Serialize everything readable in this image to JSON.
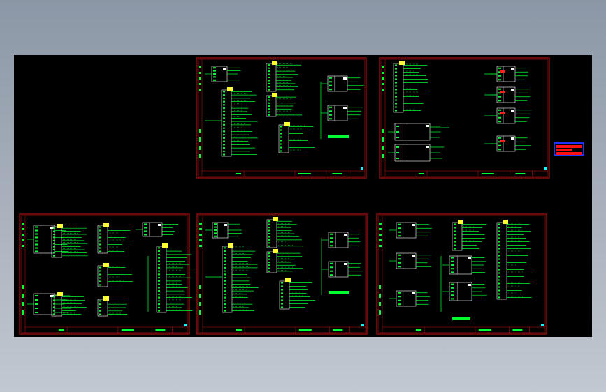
{
  "colors": {
    "background_gradient_top": "#8b97a6",
    "background_gradient_bottom": "#c2c8d0",
    "model_space": "#000000",
    "frame": "#c81414",
    "wire": "#00ff33",
    "terminal_strip": "#ffff33",
    "symbol": "#ffffff",
    "legend_border": "#2233ff",
    "legend_fill": "#ff1010"
  },
  "sheets": [
    {
      "id": "sheet-1",
      "layout": "plc-center"
    },
    {
      "id": "sheet-2",
      "layout": "modules-right"
    },
    {
      "id": "sheet-3",
      "layout": "mixed-left"
    },
    {
      "id": "sheet-4",
      "layout": "plc-center"
    },
    {
      "id": "sheet-5",
      "layout": "plc-right"
    }
  ],
  "legend": {
    "icon": "cad-legend-icon"
  }
}
